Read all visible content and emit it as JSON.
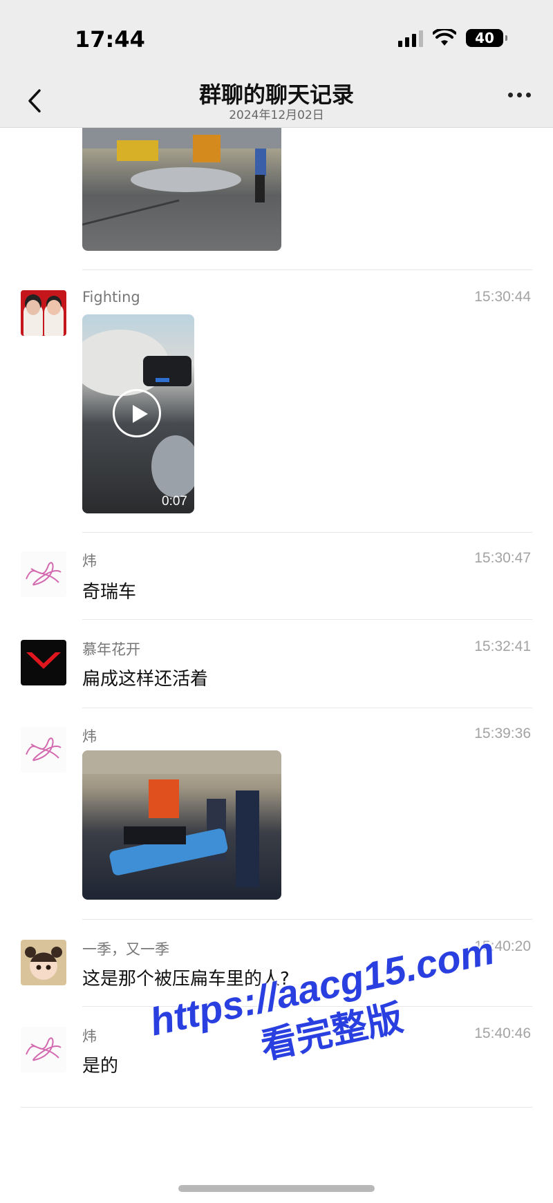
{
  "status_bar": {
    "time": "17:44",
    "battery": "40"
  },
  "header": {
    "title": "群聊的聊天记录",
    "subtitle": "2024年12月02日"
  },
  "messages": [
    {
      "sender": "Fighting",
      "time": "15:30:44",
      "video_duration": "0:07"
    },
    {
      "sender": "炜",
      "time": "15:30:47",
      "text": "奇瑞车"
    },
    {
      "sender": "慕年花开",
      "time": "15:32:41",
      "text": "扁成这样还活着"
    },
    {
      "sender": "炜",
      "time": "15:39:36"
    },
    {
      "sender": "一季，又一季",
      "time": "15:40:20",
      "text": "这是那个被压扁车里的人?"
    },
    {
      "sender": "炜",
      "time": "15:40:46",
      "text": "是的"
    }
  ],
  "watermark": {
    "url": "https://aacg15.com",
    "caption": "看完整版"
  },
  "icons": [
    "back-chevron-icon",
    "more-dots-icon",
    "signal-icon",
    "wifi-icon",
    "battery-icon",
    "play-icon"
  ]
}
